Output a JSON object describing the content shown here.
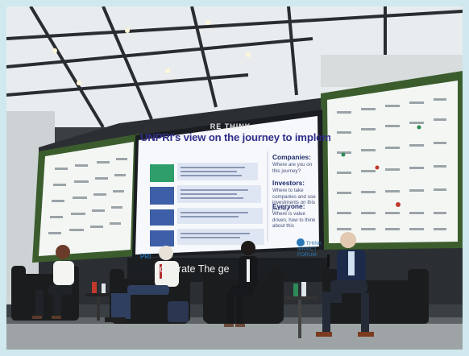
{
  "stage_backdrop": {
    "brand_mark": "RE THINK",
    "slide": {
      "title": "UNPRI's view on the journey to implement TCFD",
      "side_panel": [
        {
          "heading": "Companies:",
          "body": "Where are you on this journey?"
        },
        {
          "heading": "Investors:",
          "body": "Where to take companies and use investments on this journey"
        },
        {
          "heading": "Everyone:",
          "body": "Where is value driven, how to think about this"
        }
      ],
      "footer_logo": "PRI",
      "partner_logo": "RE THINK IMPACT FORUM"
    },
    "banner_text": "celerate The  ge"
  }
}
